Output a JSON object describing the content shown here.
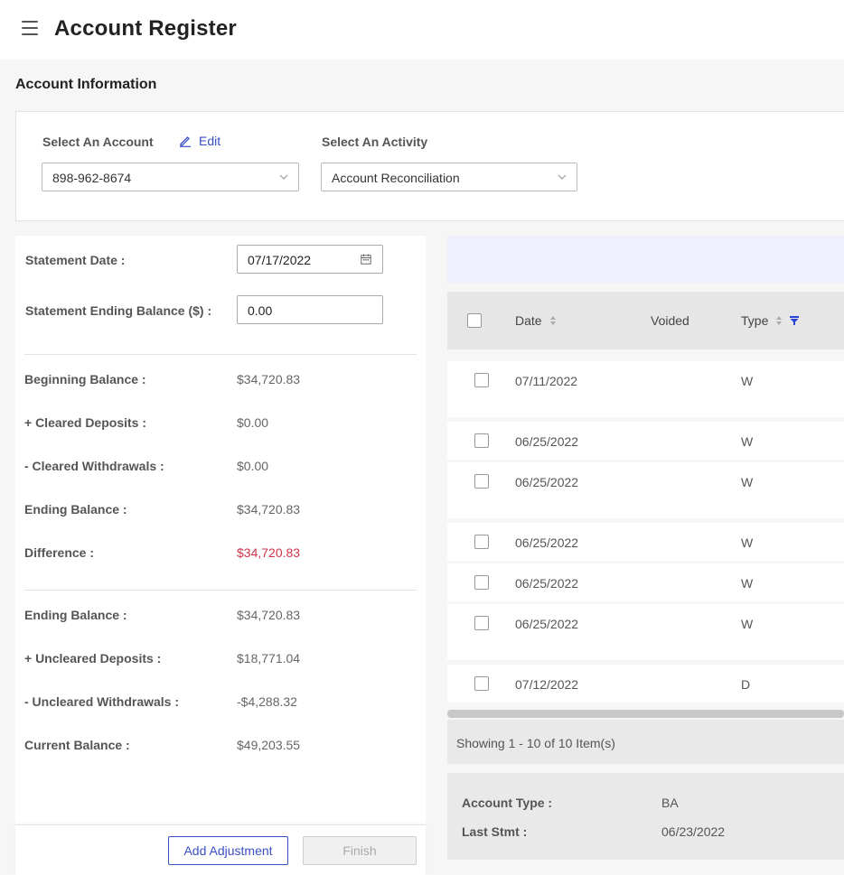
{
  "header": {
    "title": "Account Register"
  },
  "section": {
    "title": "Account Information"
  },
  "account": {
    "select_label": "Select An Account",
    "edit_label": "Edit",
    "selected": "898-962-8674",
    "activity_label": "Select An Activity",
    "activity_selected": "Account Reconciliation"
  },
  "reconcile": {
    "statement_date_label": "Statement Date",
    "statement_date_value": "07/17/2022",
    "ending_balance_label": "Statement Ending Balance ($)",
    "ending_balance_value": "0.00",
    "summary1": [
      {
        "label": "Beginning Balance",
        "value": "$34,720.83"
      },
      {
        "label": "+ Cleared Deposits",
        "value": "$0.00"
      },
      {
        "label": "- Cleared Withdrawals",
        "value": "$0.00"
      },
      {
        "label": "Ending Balance",
        "value": "$34,720.83"
      },
      {
        "label": "Difference",
        "value": "$34,720.83"
      }
    ],
    "summary2": [
      {
        "label": "Ending Balance",
        "value": "$34,720.83"
      },
      {
        "label": "+ Uncleared Deposits",
        "value": "$18,771.04"
      },
      {
        "label": "- Uncleared Withdrawals",
        "value": "-$4,288.32"
      },
      {
        "label": "Current Balance",
        "value": "$49,203.55"
      }
    ],
    "add_adjustment_label": "Add Adjustment",
    "finish_label": "Finish",
    "difference_color": "#d0344a"
  },
  "grid": {
    "columns": [
      "Date",
      "Voided",
      "Type"
    ],
    "rows": [
      {
        "date": "07/11/2022",
        "type": "W"
      },
      {
        "date": "06/25/2022",
        "type": "W"
      },
      {
        "date": "06/25/2022",
        "type": "W"
      },
      {
        "date": "06/25/2022",
        "type": "W"
      },
      {
        "date": "06/25/2022",
        "type": "W"
      },
      {
        "date": "06/25/2022",
        "type": "W"
      },
      {
        "date": "07/12/2022",
        "type": "D"
      }
    ],
    "pager_text": "Showing 1 - 10 of 10 Item(s)"
  },
  "details": {
    "account_type_label": "Account Type",
    "account_type_value": "BA",
    "last_stmt_label": "Last Stmt",
    "last_stmt_value": "06/23/2022"
  },
  "colors": {
    "accent": "#3b4fc4",
    "danger": "#d0344a"
  },
  "icons": [
    "menu-icon",
    "pencil-icon",
    "chevron-down-icon",
    "calendar-icon",
    "sort-icon",
    "filter-icon"
  ]
}
